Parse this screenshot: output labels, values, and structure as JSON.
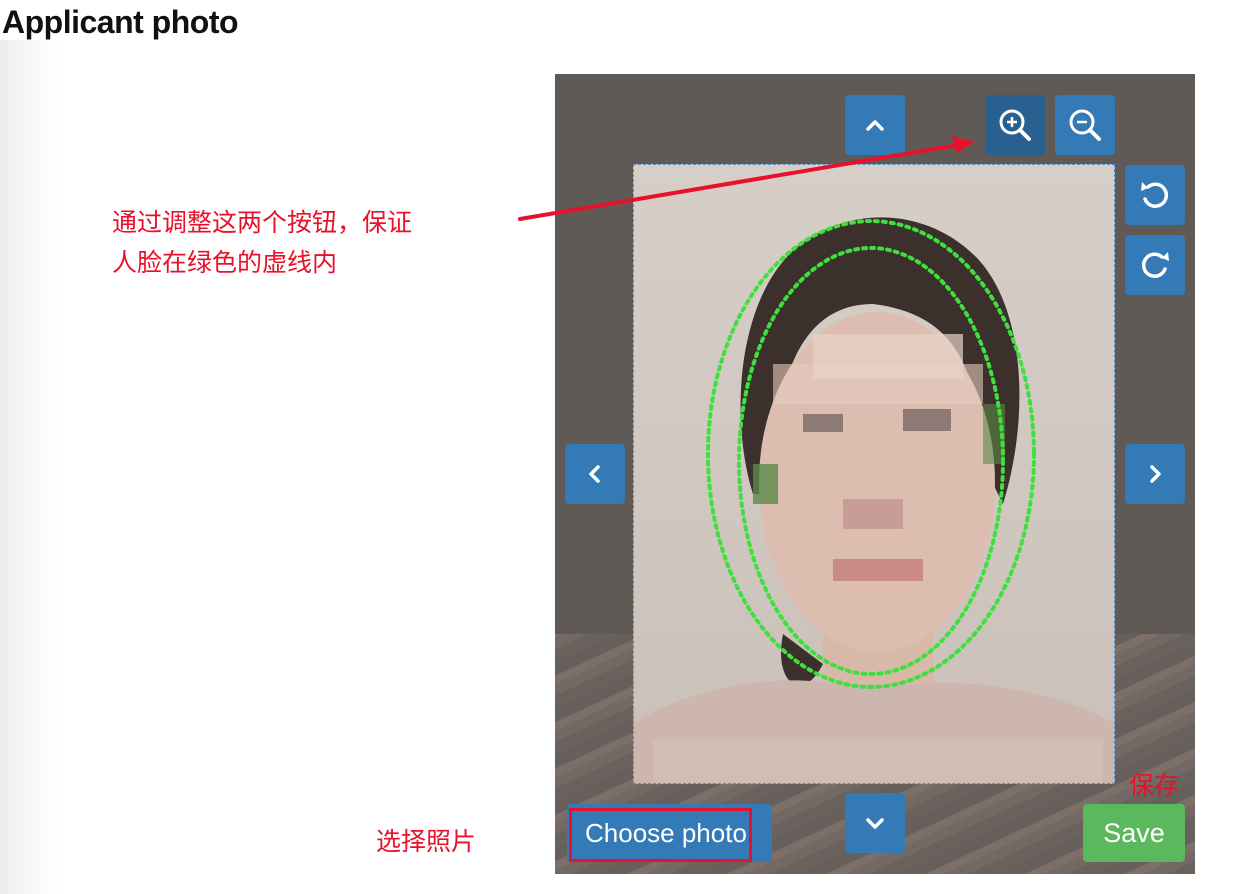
{
  "page": {
    "title": "Applicant photo"
  },
  "cropper": {
    "choose_label": "Choose photo",
    "save_label": "Save"
  },
  "annotations": {
    "zoom_hint_line1": "通过调整这两个按钮，保证",
    "zoom_hint_line2": "人脸在绿色的虚线内",
    "choose_hint": "选择照片",
    "save_hint": "保存"
  },
  "colors": {
    "button_blue": "#337ab7",
    "button_blue_active": "#286090",
    "save_green": "#5cb85c",
    "annotation_red": "#e8102a",
    "guide_green": "#3ee03e",
    "stage_bg": "#5f5a55"
  },
  "icons": {
    "move_up": "chevron-up-icon",
    "move_down": "chevron-down-icon",
    "move_left": "chevron-left-icon",
    "move_right": "chevron-right-icon",
    "zoom_in": "zoom-in-icon",
    "zoom_out": "zoom-out-icon",
    "rotate_left": "rotate-left-icon",
    "rotate_right": "rotate-right-icon"
  }
}
